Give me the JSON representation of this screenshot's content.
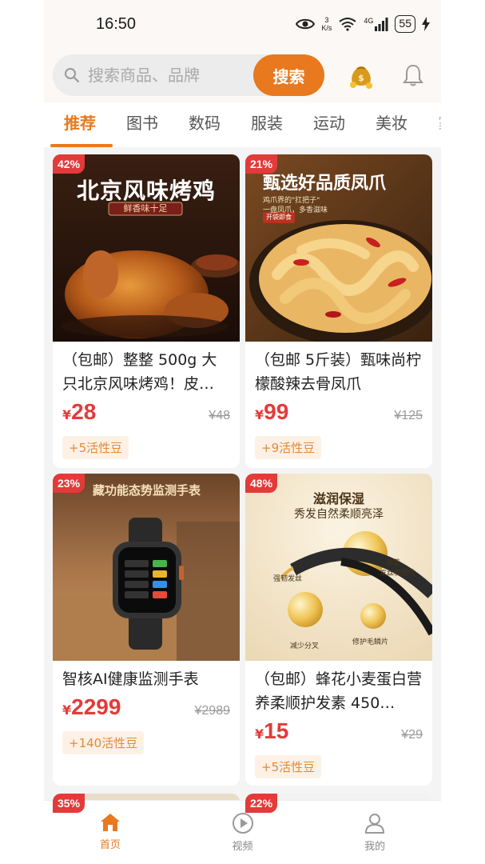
{
  "status_bar": {
    "time": "16:50",
    "net_speed_value": "3",
    "net_speed_unit": "K/s",
    "network": "4G",
    "battery": "55"
  },
  "search": {
    "placeholder": "搜索商品、品牌",
    "button_label": "搜索"
  },
  "tabs": [
    {
      "label": "推荐",
      "active": true
    },
    {
      "label": "图书",
      "active": false
    },
    {
      "label": "数码",
      "active": false
    },
    {
      "label": "服装",
      "active": false
    },
    {
      "label": "运动",
      "active": false
    },
    {
      "label": "美妆",
      "active": false
    },
    {
      "label": "家",
      "active": false
    }
  ],
  "products": [
    {
      "discount": "42%",
      "image_text": {
        "headline": "北京风味烤鸡",
        "tag": "鲜香味十足"
      },
      "title": "（包邮）整整 500g 大只北京风味烤鸡！皮…",
      "currency": "¥",
      "price": "28",
      "original_price": "¥48",
      "beans": "+5活性豆"
    },
    {
      "discount": "21%",
      "image_text": {
        "headline": "甄选好品质凤爪",
        "sub1": "鸡爪界的\"扛把子\"",
        "sub2": "一盘凤爪，多香滋味",
        "tag": "开袋即食"
      },
      "title": "（包邮 5斤装）甄味尚柠檬酸辣去骨凤爪",
      "currency": "¥",
      "price": "99",
      "original_price": "¥125",
      "beans": "+9活性豆"
    },
    {
      "discount": "23%",
      "image_text": {
        "headline": "藏功能态势监测手表"
      },
      "title": "智核AI健康监测手表",
      "currency": "¥",
      "price": "2299",
      "original_price": "¥2989",
      "beans": "+140活性豆"
    },
    {
      "discount": "48%",
      "image_text": {
        "headline": "滋润保湿",
        "sub": "秀发自然柔顺亮泽",
        "l1": "强韧发丝",
        "l2": "改善",
        "l3": "发丝梳理性",
        "l4": "减少分叉",
        "l5": "修护毛鳞片"
      },
      "title": "（包邮）蜂花小麦蛋白营养柔顺护发素 450…",
      "currency": "¥",
      "price": "15",
      "original_price": "¥29",
      "beans": "+5活性豆"
    },
    {
      "discount": "35%"
    },
    {
      "discount": "22%"
    }
  ],
  "bottom_nav": [
    {
      "label": "首页",
      "icon": "home-icon",
      "active": true
    },
    {
      "label": "视频",
      "icon": "play-icon",
      "active": false
    },
    {
      "label": "我的",
      "icon": "user-icon",
      "active": false
    }
  ],
  "colors": {
    "accent": "#e8791f",
    "price": "#e33a3a",
    "badge": "#e33a3a"
  }
}
